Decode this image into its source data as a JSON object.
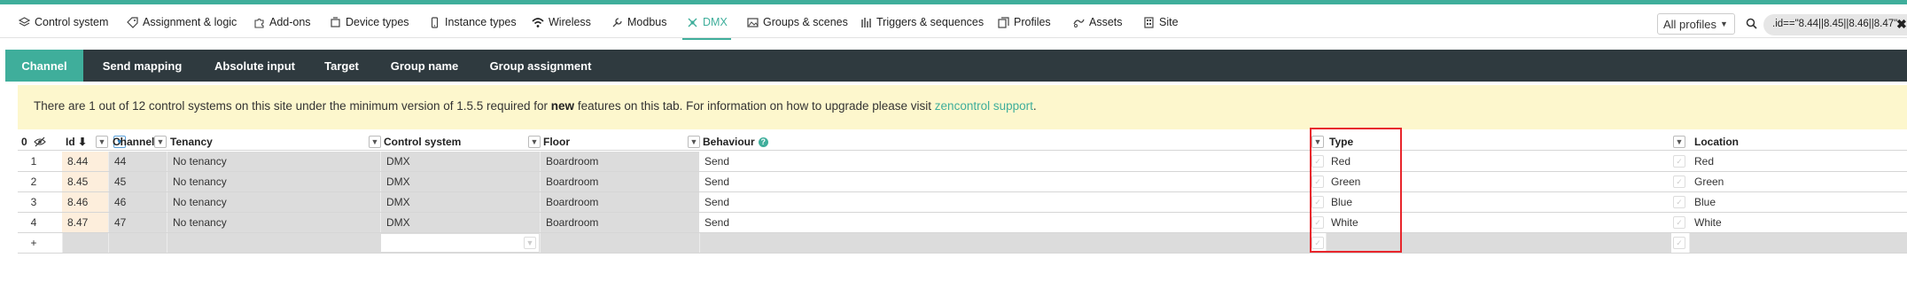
{
  "nav": {
    "items": [
      {
        "label": "Control system",
        "icon": "control-system-icon"
      },
      {
        "label": "Assignment & logic",
        "icon": "tag-icon"
      },
      {
        "label": "Add-ons",
        "icon": "puzzle-icon"
      },
      {
        "label": "Device types",
        "icon": "device-icon"
      },
      {
        "label": "Instance types",
        "icon": "phone-icon"
      },
      {
        "label": "Wireless",
        "icon": "wifi-icon"
      },
      {
        "label": "Modbus",
        "icon": "wrench-icon"
      },
      {
        "label": "DMX",
        "icon": "dmx-icon"
      },
      {
        "label": "Groups & scenes",
        "icon": "image-icon"
      },
      {
        "label": "Triggers & sequences",
        "icon": "bars-icon"
      },
      {
        "label": "Profiles",
        "icon": "copy-icon"
      },
      {
        "label": "Assets",
        "icon": "assets-icon"
      },
      {
        "label": "Site",
        "icon": "building-icon"
      }
    ],
    "profile_select": "All profiles",
    "search_value": ".id==\"8.44||8.45||8.46||8.47\"",
    "clear_label": "✖",
    "accent": "#3fae9b"
  },
  "tabs": [
    "Channel",
    "Send mapping",
    "Absolute input",
    "Target",
    "Group name",
    "Group assignment"
  ],
  "banner": {
    "pre": "There are 1 out of 12 control systems on this site under the minimum version of 1.5.5 required for ",
    "bold": "new",
    "mid": " features on this tab. For information on how to upgrade please visit ",
    "link": "zencontrol support",
    "post": ".",
    "background": "#fdf7cd"
  },
  "table": {
    "count": "0",
    "headers": {
      "id": "Id ⬇",
      "channel": "Channel",
      "tenancy": "Tenancy",
      "control_system": "Control system",
      "floor": "Floor",
      "behaviour": "Behaviour",
      "type": "Type",
      "location": "Location"
    },
    "rows": [
      {
        "n": "1",
        "id": "8.44",
        "channel": "44",
        "tenancy": "No tenancy",
        "control_system": "DMX",
        "floor": "Boardroom",
        "behaviour": "Send",
        "type": "Red",
        "location": "Red"
      },
      {
        "n": "2",
        "id": "8.45",
        "channel": "45",
        "tenancy": "No tenancy",
        "control_system": "DMX",
        "floor": "Boardroom",
        "behaviour": "Send",
        "type": "Green",
        "location": "Green"
      },
      {
        "n": "3",
        "id": "8.46",
        "channel": "46",
        "tenancy": "No tenancy",
        "control_system": "DMX",
        "floor": "Boardroom",
        "behaviour": "Send",
        "type": "Blue",
        "location": "Blue"
      },
      {
        "n": "4",
        "id": "8.47",
        "channel": "47",
        "tenancy": "No tenancy",
        "control_system": "DMX",
        "floor": "Boardroom",
        "behaviour": "Send",
        "type": "White",
        "location": "White"
      }
    ],
    "add_row_label": "+",
    "highlight_color": "#e8262c"
  }
}
